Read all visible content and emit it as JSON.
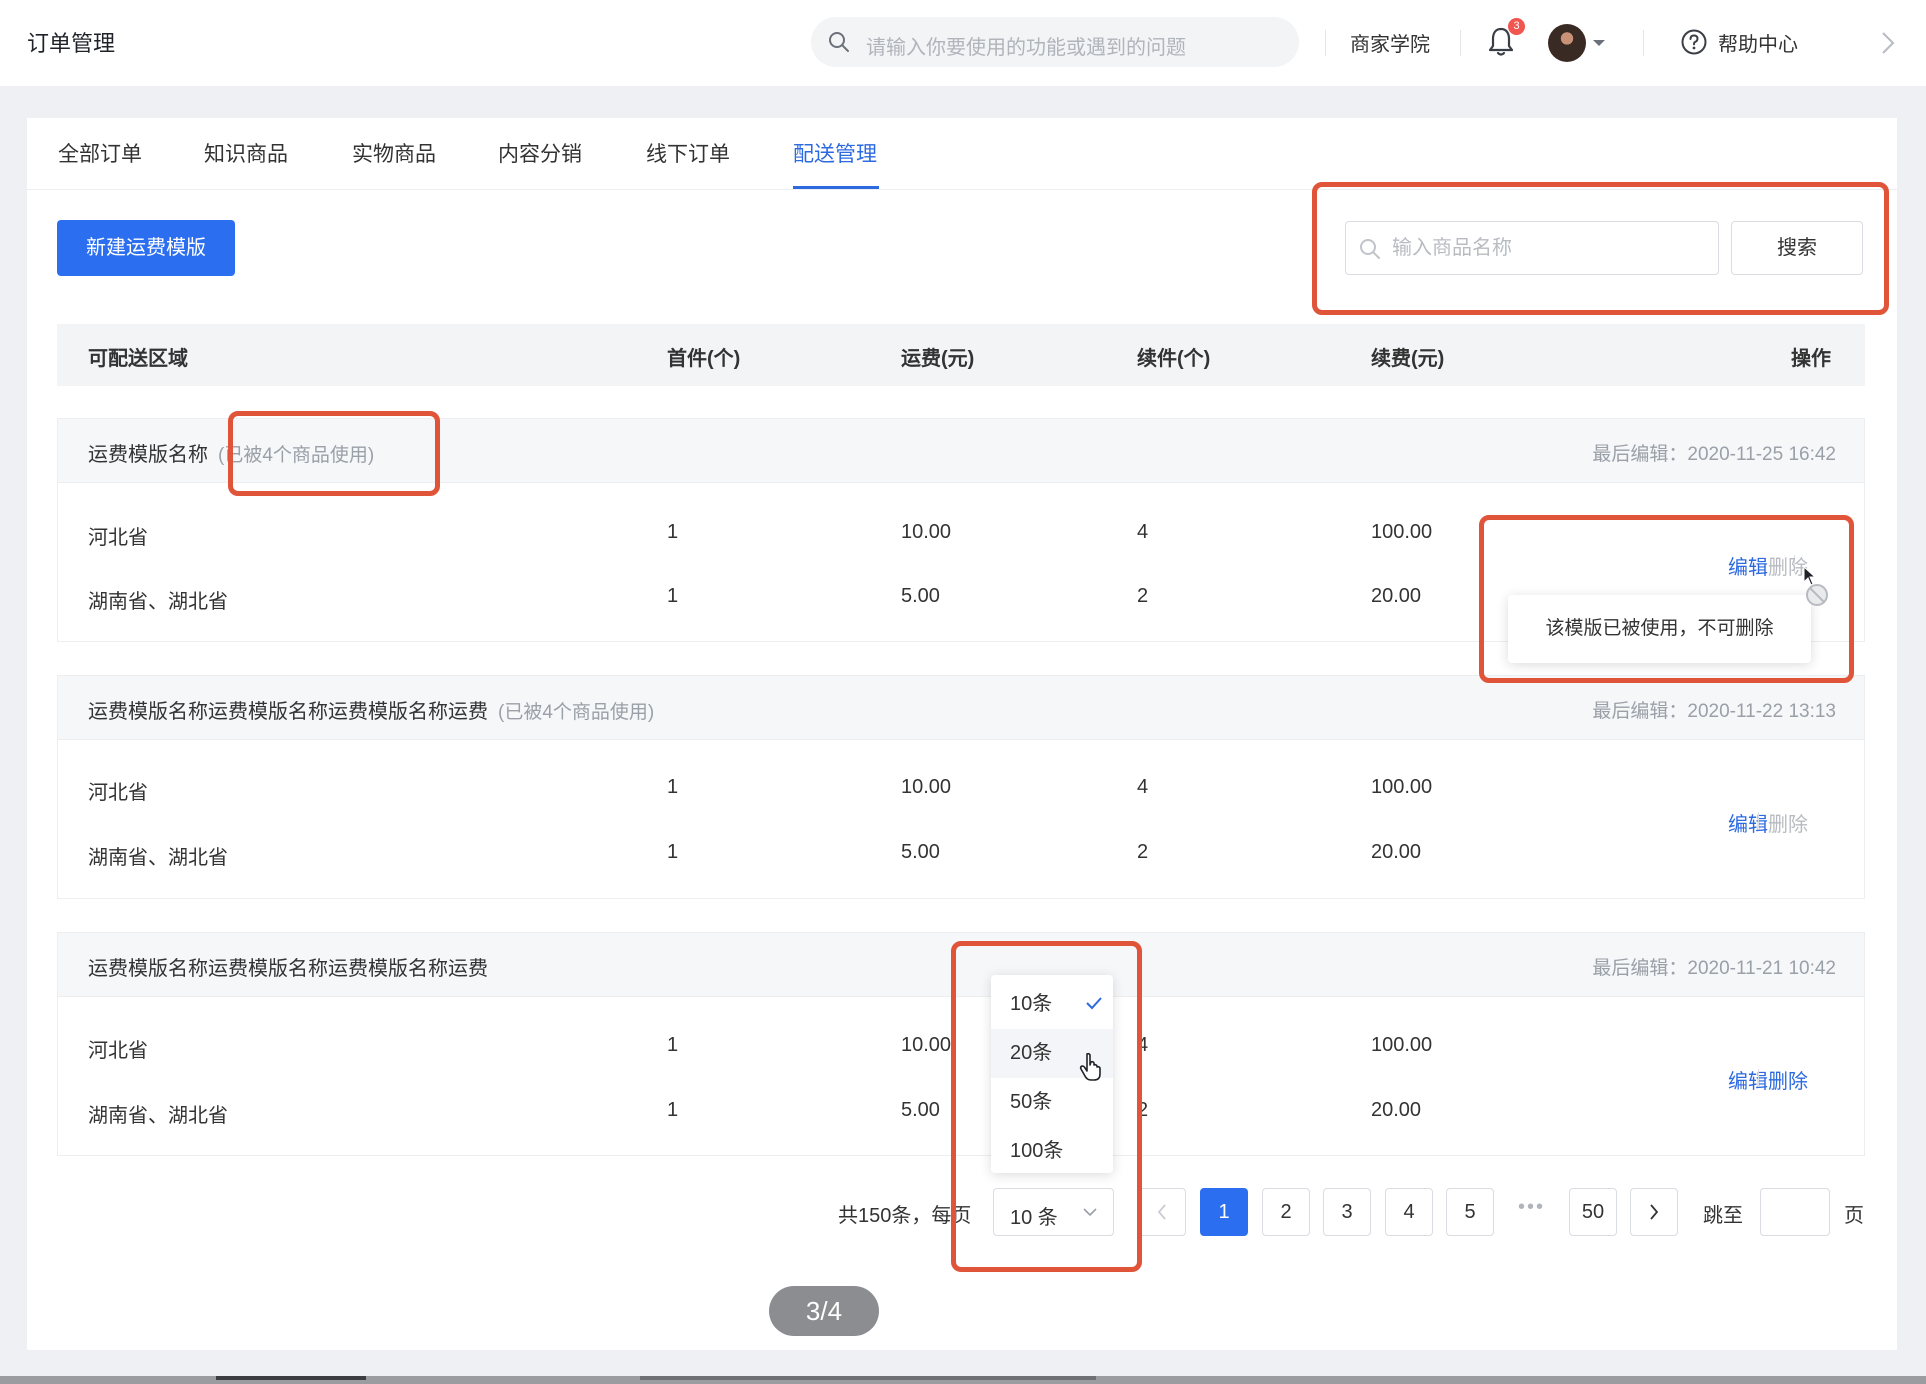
{
  "topbar": {
    "page_title": "订单管理",
    "search_placeholder": "请输入你要使用的功能或遇到的问题",
    "academy": "商家学院",
    "notification_badge": "3",
    "help": "帮助中心"
  },
  "tabs": [
    {
      "label": "全部订单"
    },
    {
      "label": "知识商品"
    },
    {
      "label": "实物商品"
    },
    {
      "label": "内容分销"
    },
    {
      "label": "线下订单"
    },
    {
      "label": "配送管理",
      "active": true
    }
  ],
  "toolbar": {
    "new_button": "新建运费模版",
    "search_placeholder": "输入商品名称",
    "search_button": "搜索"
  },
  "table": {
    "headers": [
      "可配送区域",
      "首件(个)",
      "运费(元)",
      "续件(个)",
      "续费(元)",
      "操作"
    ]
  },
  "templates": [
    {
      "name": "运费模版名称",
      "usage": "(已被4个商品使用)",
      "last_edit": "最后编辑：2020-11-25 16:42",
      "rows": [
        {
          "region": "河北省",
          "first": "1",
          "fee": "10.00",
          "extra": "4",
          "extra_fee": "100.00"
        },
        {
          "region": "湖南省、湖北省",
          "first": "1",
          "fee": "5.00",
          "extra": "2",
          "extra_fee": "20.00"
        }
      ],
      "edit": "编辑",
      "delete": "删除",
      "delete_enabled": false
    },
    {
      "name": "运费模版名称运费模版名称运费模版名称运费",
      "usage": "(已被4个商品使用)",
      "last_edit": "最后编辑：2020-11-22 13:13",
      "rows": [
        {
          "region": "河北省",
          "first": "1",
          "fee": "10.00",
          "extra": "4",
          "extra_fee": "100.00"
        },
        {
          "region": "湖南省、湖北省",
          "first": "1",
          "fee": "5.00",
          "extra": "2",
          "extra_fee": "20.00"
        }
      ],
      "edit": "编辑",
      "delete": "删除",
      "delete_enabled": false
    },
    {
      "name": "运费模版名称运费模版名称运费模版名称运费",
      "usage": "",
      "last_edit": "最后编辑：2020-11-21 10:42",
      "rows": [
        {
          "region": "河北省",
          "first": "1",
          "fee": "10.00",
          "extra": "4",
          "extra_fee": "100.00"
        },
        {
          "region": "湖南省、湖北省",
          "first": "1",
          "fee": "5.00",
          "extra": "2",
          "extra_fee": "20.00"
        }
      ],
      "edit": "编辑",
      "delete": "删除",
      "delete_enabled": true
    }
  ],
  "tooltip": "该模版已被使用，不可删除",
  "page_size_options": [
    {
      "label": "10条",
      "selected": true
    },
    {
      "label": "20条",
      "hover": true
    },
    {
      "label": "50条"
    },
    {
      "label": "100条"
    }
  ],
  "pagination": {
    "total": "共150条，每页",
    "page_size": "10 条",
    "pages": [
      "1",
      "2",
      "3",
      "4",
      "5"
    ],
    "ellipsis": "•••",
    "last_page": "50",
    "current": "1",
    "jump_label": "跳至",
    "page_suffix": "页"
  },
  "slide_counter": "3/4",
  "colors": {
    "primary": "#2b6ff0",
    "highlight": "#e0553a",
    "muted": "#9aa0a8",
    "badge": "#f0554f"
  }
}
